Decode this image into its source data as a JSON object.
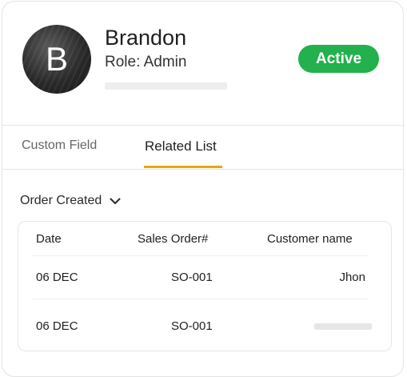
{
  "profile": {
    "avatar_initial": "B",
    "name": "Brandon",
    "role": "Role: Admin",
    "status": "Active",
    "status_color": "#22b14c"
  },
  "tabs": [
    {
      "label": "Custom Field",
      "active": false
    },
    {
      "label": "Related List",
      "active": true
    }
  ],
  "accent_color": "#e8a800",
  "filter": {
    "label": "Order Created",
    "icon": "chevron-down-icon"
  },
  "table": {
    "headers": [
      "Date",
      "Sales Order#",
      "Customer name"
    ],
    "rows": [
      {
        "date": "06 DEC",
        "sales_order": "SO-001",
        "customer": "Jhon"
      },
      {
        "date": "06 DEC",
        "sales_order": "SO-001",
        "customer": ""
      }
    ]
  }
}
